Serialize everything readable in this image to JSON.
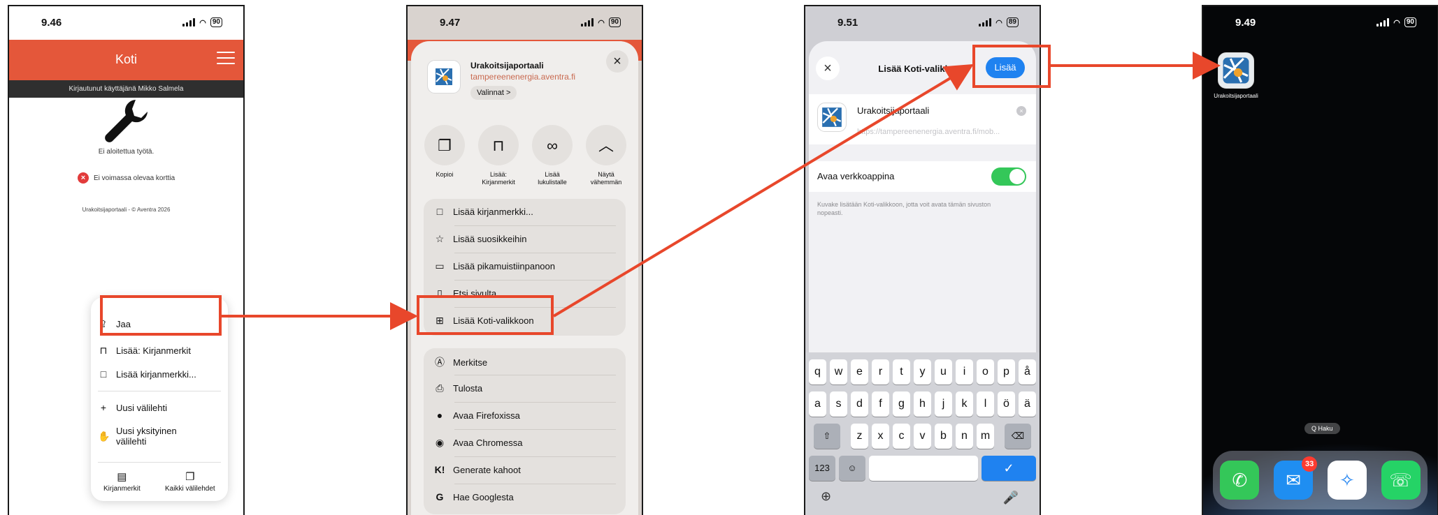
{
  "colors": {
    "accent_orange": "#e4573a",
    "annotation_red": "#e8472b",
    "ios_blue": "#1f82f0",
    "toggle_green": "#34c759"
  },
  "phone1": {
    "time": "9.46",
    "battery": "90",
    "header_title": "Koti",
    "logged_in": "Kirjautunut käyttäjänä Mikko Salmela",
    "no_work": "Ei aloitettua työtä.",
    "no_card": "Ei voimassa olevaa korttia",
    "footer": "Urakoitsijaportaali - © Aventra 2026",
    "menu": {
      "share": "Jaa",
      "add_bookmarks": "Lisää: Kirjanmerkit",
      "add_bookmark": "Lisää kirjanmerkki...",
      "new_tab": "Uusi välilehti",
      "new_private_tab": "Uusi yksityinen välilehti",
      "bookmarks": "Kirjanmerkit",
      "all_tabs": "Kaikki välilehdet"
    }
  },
  "phone2": {
    "time": "9.47",
    "battery": "90",
    "app_name": "Urakoitsijaportaali",
    "domain": "tampereenenergia.aventra.fi",
    "options": "Valinnat >",
    "actions": [
      {
        "icon": "copy-icon",
        "label": "Kopioi"
      },
      {
        "icon": "bookmark-icon",
        "label": "Lisää: Kirjanmerkit"
      },
      {
        "icon": "glasses-icon",
        "label": "Lisää lukulistalle"
      },
      {
        "icon": "chevron-up-icon",
        "label": "Näytä vähemmän"
      }
    ],
    "group1": [
      "Lisää kirjanmerkki...",
      "Lisää suosikkeihin",
      "Lisää pikamuistiinpanoon",
      "Etsi sivulta",
      "Lisää Koti-valikkoon"
    ],
    "group2": [
      "Merkitse",
      "Tulosta",
      "Avaa Firefoxissa",
      "Avaa Chromessa",
      "Generate kahoot",
      "Hae Googlesta"
    ]
  },
  "phone3": {
    "time": "9.51",
    "battery": "89",
    "title": "Lisää Koti-valikkoon",
    "add_button": "Lisää",
    "app_name": "Urakoitsijaportaali",
    "url": "https://tampereenenergia.aventra.fi/mob...",
    "toggle_label": "Avaa verkkoappina",
    "toggle_on": true,
    "hint": "Kuvake lisätään Koti-valikkoon, jotta voit avata tämän sivuston nopeasti.",
    "keyboard": {
      "row1": [
        "q",
        "w",
        "e",
        "r",
        "t",
        "y",
        "u",
        "i",
        "o",
        "p",
        "å"
      ],
      "row2": [
        "a",
        "s",
        "d",
        "f",
        "g",
        "h",
        "j",
        "k",
        "l",
        "ö",
        "ä"
      ],
      "row3": [
        "z",
        "x",
        "c",
        "v",
        "b",
        "n",
        "m"
      ],
      "shift": "⇧",
      "backspace": "⌫",
      "numbers": "123",
      "emoji": "☺",
      "done": "✓",
      "globe": "⊕",
      "mic": "🎤"
    }
  },
  "phone4": {
    "time": "9.49",
    "battery": "90",
    "app_label": "Urakoitsijaportaali",
    "search": "Q Haku",
    "mail_badge": "33",
    "dock": [
      "phone-icon",
      "mail-icon",
      "safari-icon",
      "whatsapp-icon"
    ]
  }
}
